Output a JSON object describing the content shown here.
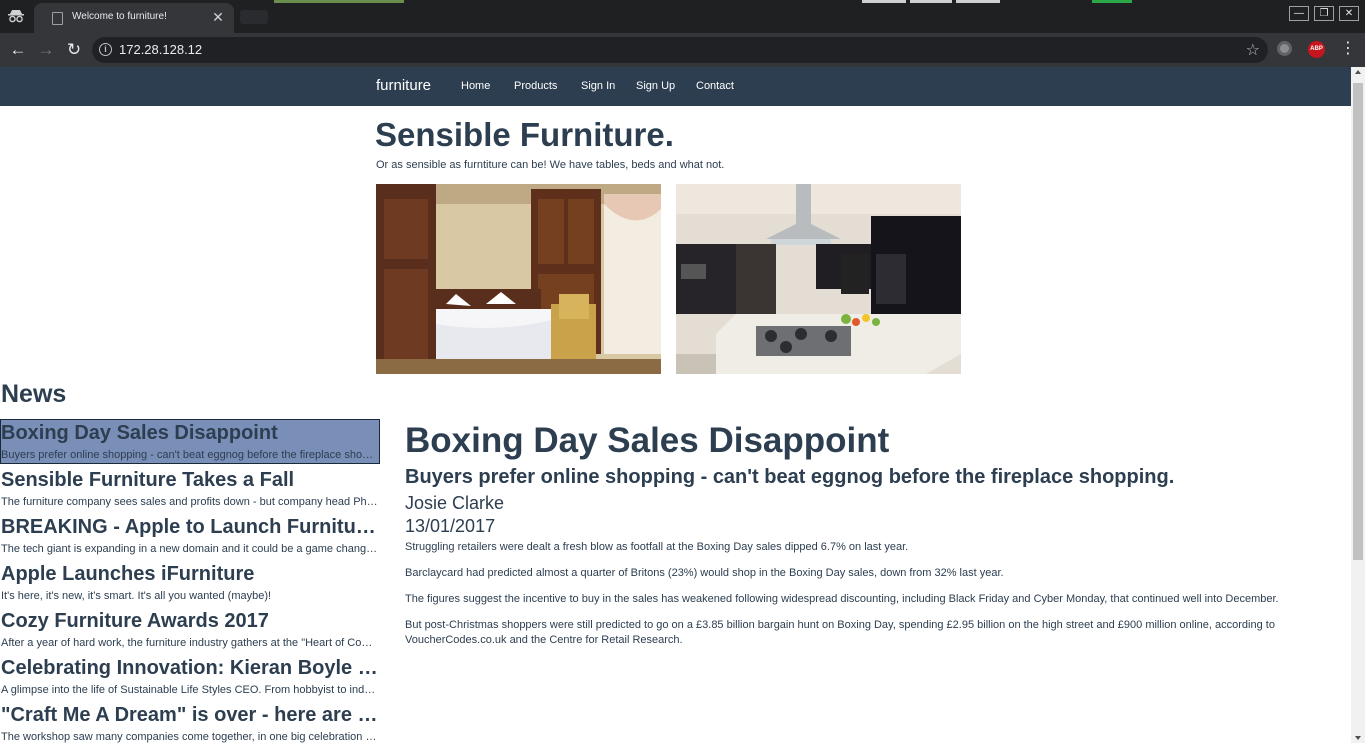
{
  "browser": {
    "tab_title": "Welcome to furniture!",
    "url": "172.28.128.12"
  },
  "site": {
    "brand": "furniture",
    "nav": [
      "Home",
      "Products",
      "Sign In",
      "Sign Up",
      "Contact"
    ],
    "hero_title": "Sensible Furniture.",
    "hero_subtitle": "Or as sensible as furntiture can be! We have tables, beds and what not."
  },
  "news": {
    "heading": "News",
    "items": [
      {
        "title": "Boxing Day Sales Disappoint",
        "summary": "Buyers prefer online shopping - can't beat eggnog before the fireplace shopping."
      },
      {
        "title": "Sensible Furniture Takes a Fall",
        "summary": "The furniture company sees sales and profits down - but company head Phil says there is no need to panic."
      },
      {
        "title": "BREAKING - Apple to Launch Furniture Line",
        "summary": "The tech giant is expanding in a new domain and it could be a game changer for the whole industry."
      },
      {
        "title": "Apple Launches iFurniture",
        "summary": "It's here, it's new, it's smart. It's all you wanted (maybe)!"
      },
      {
        "title": "Cozy Furniture Awards 2017",
        "summary": "After a year of hard work, the furniture industry gathers at the \"Heart of Comfort\" awards night."
      },
      {
        "title": "Celebrating Innovation: Kieran Boyle Speaks",
        "summary": "A glimpse into the life of Sustainable Life Styles CEO. From hobbyist to industry leader."
      },
      {
        "title": "\"Craft Me A Dream\" is over - here are the winners",
        "summary": "The workshop saw many companies come together, in one big celebration of craft."
      }
    ]
  },
  "article": {
    "title": "Boxing Day Sales Disappoint",
    "subtitle": "Buyers prefer online shopping - can't beat eggnog before the fireplace shopping.",
    "author": "Josie Clarke",
    "date": "13/01/2017",
    "paragraphs": [
      "Struggling retailers were dealt a fresh blow as footfall at the Boxing Day sales dipped 6.7% on last year.",
      "Barclaycard had predicted almost a quarter of Britons (23%) would shop in the Boxing Day sales, down from 32% last year.",
      "The figures suggest the incentive to buy in the sales has weakened following widespread discounting, including Black Friday and Cyber Monday, that continued well into December.",
      "But post-Christmas shoppers were still predicted to go on a £3.85 billion bargain hunt on Boxing Day, spending £2.95 billion on the high street and £900 million online, according to VoucherCodes.co.uk and the Centre for Retail Research."
    ]
  },
  "colors": {
    "navbar": "#2c3e50",
    "text": "#2c3e50",
    "active_item": "#7a8fb7",
    "browser_frame": "#1f2022",
    "browser_toolbar": "#35363a"
  }
}
